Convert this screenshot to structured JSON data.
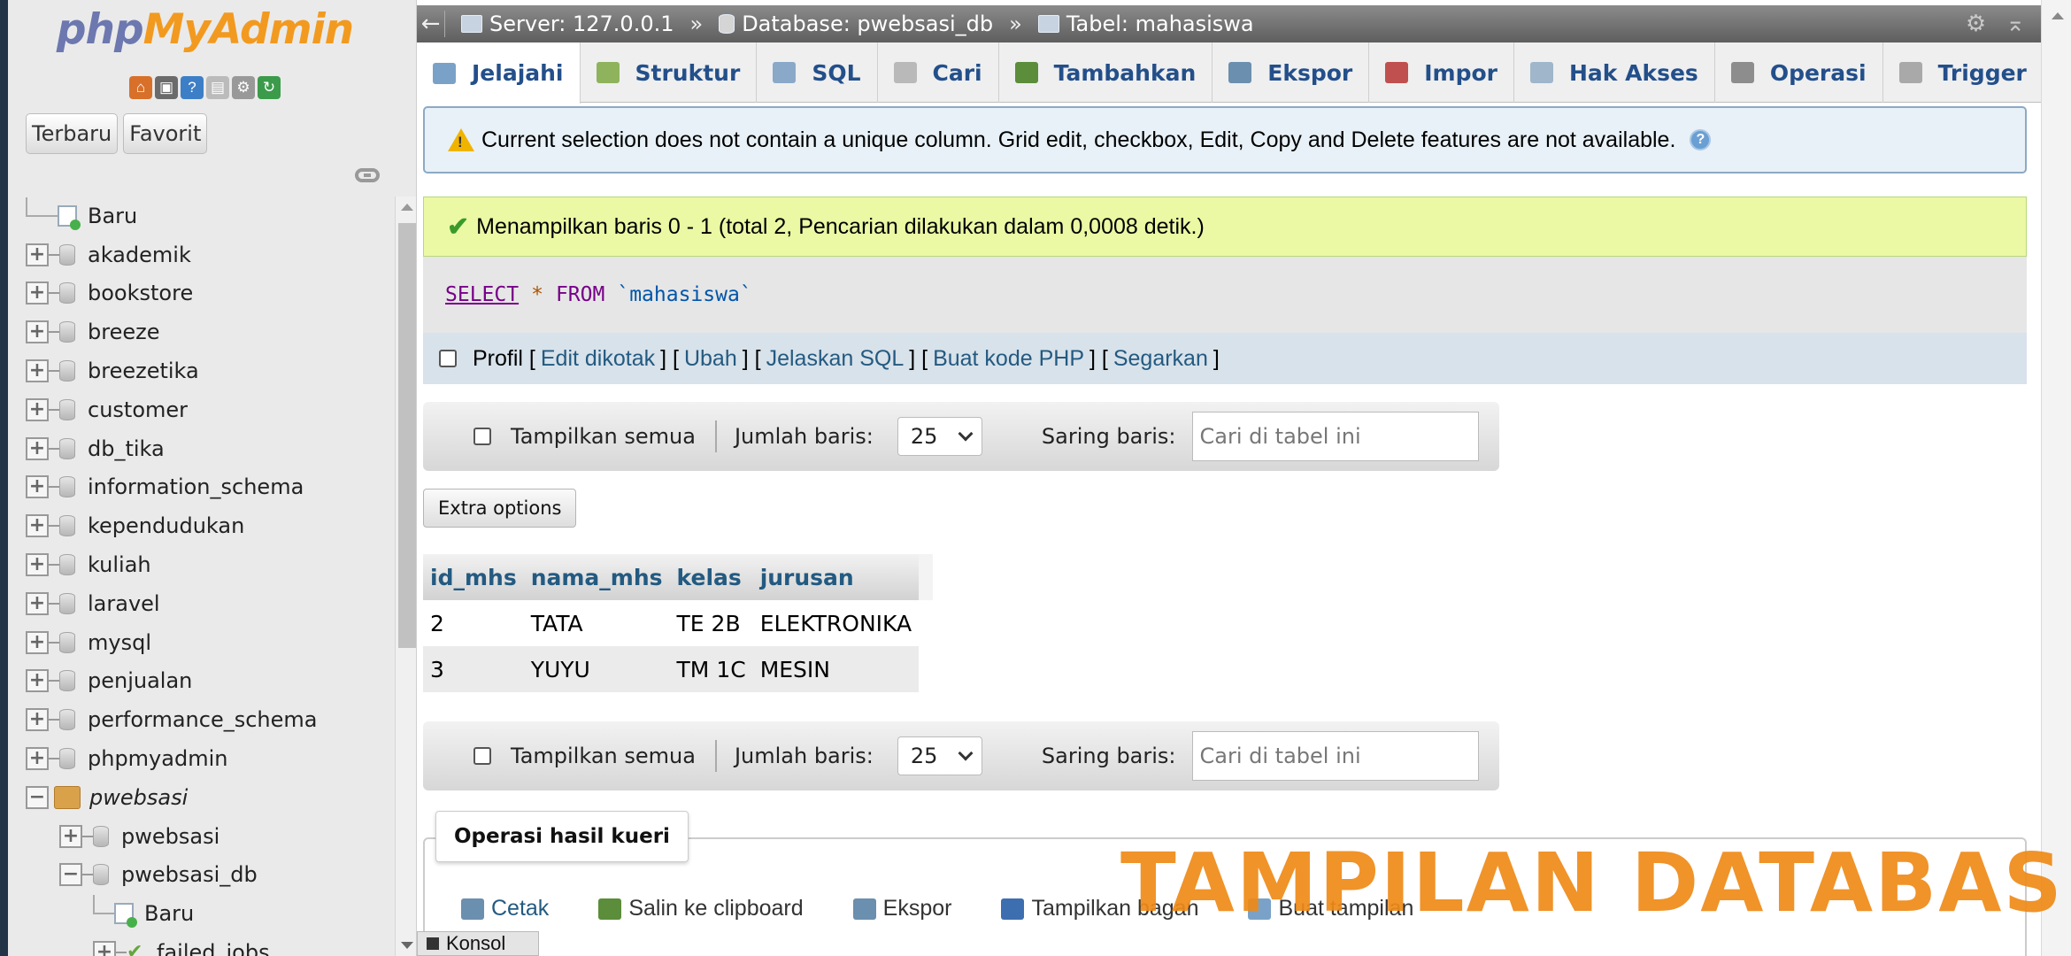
{
  "logo": {
    "part1": "php",
    "part2": "MyAdmin"
  },
  "sidebar": {
    "quick_icons": [
      {
        "icon": "home-icon",
        "color": "#d8702a",
        "glyph": "⌂"
      },
      {
        "icon": "exit-icon",
        "color": "#6b6b6b",
        "glyph": "▣"
      },
      {
        "icon": "help-icon",
        "color": "#3d7fc6",
        "glyph": "?"
      },
      {
        "icon": "docs-icon",
        "color": "#bbbbbb",
        "glyph": "▤"
      },
      {
        "icon": "settings-icon",
        "color": "#999999",
        "glyph": "⚙"
      },
      {
        "icon": "reload-icon",
        "color": "#3b9b4a",
        "glyph": "↻"
      }
    ],
    "recent_label": "Terbaru",
    "favorite_label": "Favorit",
    "tree": [
      {
        "label": "Baru",
        "type": "new"
      },
      {
        "label": "akademik",
        "type": "db"
      },
      {
        "label": "bookstore",
        "type": "db"
      },
      {
        "label": "breeze",
        "type": "db"
      },
      {
        "label": "breezetika",
        "type": "db"
      },
      {
        "label": "customer",
        "type": "db"
      },
      {
        "label": "db_tika",
        "type": "db"
      },
      {
        "label": "information_schema",
        "type": "db"
      },
      {
        "label": "kependudukan",
        "type": "db"
      },
      {
        "label": "kuliah",
        "type": "db"
      },
      {
        "label": "laravel",
        "type": "db"
      },
      {
        "label": "mysql",
        "type": "db"
      },
      {
        "label": "penjualan",
        "type": "db"
      },
      {
        "label": "performance_schema",
        "type": "db"
      },
      {
        "label": "phpmyadmin",
        "type": "db"
      },
      {
        "label": "pwebsasi",
        "type": "group"
      },
      {
        "label": "pwebsasi",
        "type": "subdb"
      },
      {
        "label": "pwebsasi_db",
        "type": "subdb-open"
      },
      {
        "label": "Baru",
        "type": "subnew"
      },
      {
        "label": "failed_jobs",
        "type": "subtable"
      }
    ]
  },
  "breadcrumb": {
    "server": "Server: 127.0.0.1",
    "database": "Database: pwebsasi_db",
    "table": "Tabel: mahasiswa",
    "separator": "»",
    "back": "←"
  },
  "tabs": [
    {
      "label": "Jelajahi",
      "icon": "browse-icon",
      "color": "#7aa2c8",
      "active": true
    },
    {
      "label": "Struktur",
      "icon": "structure-icon",
      "color": "#8fb35c"
    },
    {
      "label": "SQL",
      "icon": "sql-icon",
      "color": "#8aa9c9"
    },
    {
      "label": "Cari",
      "icon": "search-icon",
      "color": "#b9b9b9"
    },
    {
      "label": "Tambahkan",
      "icon": "insert-icon",
      "color": "#5b8d3a"
    },
    {
      "label": "Ekspor",
      "icon": "export-icon",
      "color": "#6b8fae"
    },
    {
      "label": "Impor",
      "icon": "import-icon",
      "color": "#c05050"
    },
    {
      "label": "Hak Akses",
      "icon": "privileges-icon",
      "color": "#9fb6cb"
    },
    {
      "label": "Operasi",
      "icon": "operations-icon",
      "color": "#8d8d8d"
    },
    {
      "label": "Trigger",
      "icon": "trigger-icon",
      "color": "#a9a9a9"
    }
  ],
  "warning": {
    "text": "Current selection does not contain a unique column. Grid edit, checkbox, Edit, Copy and Delete features are not available.",
    "color": "#f0b400"
  },
  "success": {
    "text": "Menampilkan baris 0 - 1 (total 2, Pencarian dilakukan dalam 0,0008 detik.)",
    "color": "#ebf8a4"
  },
  "sql": {
    "select": "SELECT",
    "star": "*",
    "from": "FROM",
    "table": "`mahasiswa`"
  },
  "profile": {
    "label": "Profil",
    "links": [
      "Edit dikotak",
      "Ubah",
      "Jelaskan SQL",
      "Buat kode PHP",
      "Segarkan"
    ]
  },
  "navigation": {
    "show_all": "Tampilkan semua",
    "rows_label": "Jumlah baris:",
    "rows_value": "25",
    "filter_label": "Saring baris:",
    "filter_placeholder": "Cari di tabel ini"
  },
  "extra_options": "Extra options",
  "table": {
    "columns": [
      "id_mhs",
      "nama_mhs",
      "kelas",
      "jurusan"
    ],
    "rows": [
      [
        "2",
        "TATA",
        "TE 2B",
        "ELEKTRONIKA"
      ],
      [
        "3",
        "YUYU",
        "TM 1C",
        "MESIN"
      ]
    ]
  },
  "query_ops": {
    "legend": "Operasi hasil kueri",
    "items": [
      {
        "label": "Cetak",
        "icon": "print-icon",
        "color": "#6b8fae",
        "link": true
      },
      {
        "label": "Salin ke clipboard",
        "icon": "clipboard-icon",
        "color": "#5b8d3a",
        "link": false
      },
      {
        "label": "Ekspor",
        "icon": "export-icon",
        "color": "#6b8fae",
        "link": false
      },
      {
        "label": "Tampilkan bagan",
        "icon": "chart-icon",
        "color": "#3d6fb0",
        "link": false
      },
      {
        "label": "Buat tampilan",
        "icon": "view-icon",
        "color": "#7aa2c8",
        "link": false
      }
    ]
  },
  "console": "Konsol",
  "watermark": "TAMPILAN DATABASE",
  "accent_color": "#ef8a17"
}
